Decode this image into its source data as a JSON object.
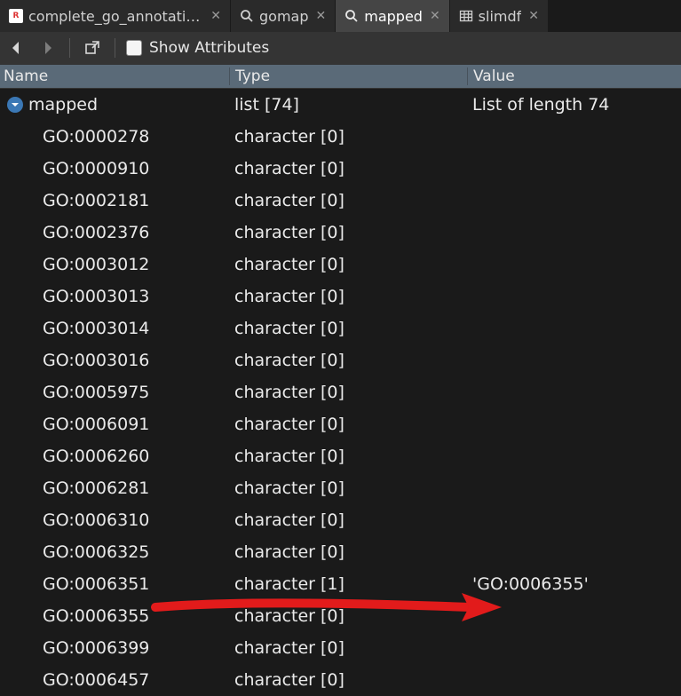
{
  "tabs": [
    {
      "label": "complete_go_annotation_noteboo…",
      "icon": "rmd",
      "active": false
    },
    {
      "label": "gomap",
      "icon": "search",
      "active": false
    },
    {
      "label": "mapped",
      "icon": "search",
      "active": true
    },
    {
      "label": "slimdf",
      "icon": "table",
      "active": false
    }
  ],
  "toolbar": {
    "show_attributes_label": "Show Attributes"
  },
  "columns": {
    "name": "Name",
    "type": "Type",
    "value": "Value"
  },
  "root": {
    "name": "mapped",
    "type": "list [74]",
    "value": "List of length 74"
  },
  "items": [
    {
      "name": "GO:0000278",
      "type": "character [0]",
      "value": ""
    },
    {
      "name": "GO:0000910",
      "type": "character [0]",
      "value": ""
    },
    {
      "name": "GO:0002181",
      "type": "character [0]",
      "value": ""
    },
    {
      "name": "GO:0002376",
      "type": "character [0]",
      "value": ""
    },
    {
      "name": "GO:0003012",
      "type": "character [0]",
      "value": ""
    },
    {
      "name": "GO:0003013",
      "type": "character [0]",
      "value": ""
    },
    {
      "name": "GO:0003014",
      "type": "character [0]",
      "value": ""
    },
    {
      "name": "GO:0003016",
      "type": "character [0]",
      "value": ""
    },
    {
      "name": "GO:0005975",
      "type": "character [0]",
      "value": ""
    },
    {
      "name": "GO:0006091",
      "type": "character [0]",
      "value": ""
    },
    {
      "name": "GO:0006260",
      "type": "character [0]",
      "value": ""
    },
    {
      "name": "GO:0006281",
      "type": "character [0]",
      "value": ""
    },
    {
      "name": "GO:0006310",
      "type": "character [0]",
      "value": ""
    },
    {
      "name": "GO:0006325",
      "type": "character [0]",
      "value": ""
    },
    {
      "name": "GO:0006351",
      "type": "character [1]",
      "value": "'GO:0006355'"
    },
    {
      "name": "GO:0006355",
      "type": "character [0]",
      "value": ""
    },
    {
      "name": "GO:0006399",
      "type": "character [0]",
      "value": ""
    },
    {
      "name": "GO:0006457",
      "type": "character [0]",
      "value": ""
    }
  ]
}
